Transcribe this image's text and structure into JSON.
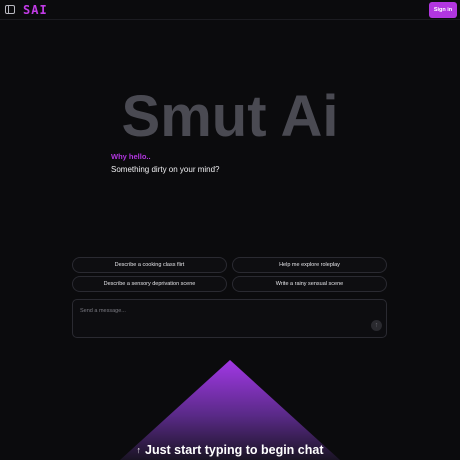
{
  "header": {
    "logo": "SAI",
    "signin_label": "Sign in",
    "sidebar_toggle_icon": "sidebar-toggle-icon"
  },
  "hero": {
    "title": "Smut Ai",
    "greeting": "Why hello..",
    "subtitle": "Something dirty on your mind?"
  },
  "suggestions": [
    "Describe a cooking class flirt",
    "Help me explore roleplay",
    "Describe a sensory deprivation scene",
    "Write a rainy sensual scene"
  ],
  "composer": {
    "placeholder": "Send a message...",
    "send_icon": "arrow-up-icon"
  },
  "cta": {
    "arrow": "↑",
    "text": "Just start typing to begin chat"
  },
  "colors": {
    "background": "#0b0b0d",
    "accent": "#b236e0",
    "hero_text": "#4a4a52"
  }
}
